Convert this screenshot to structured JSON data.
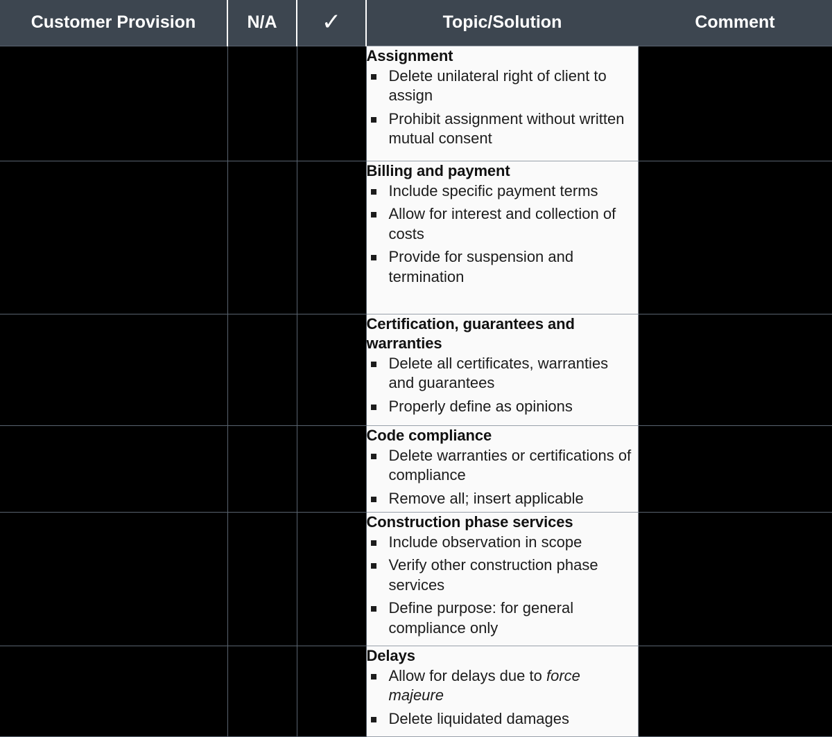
{
  "table": {
    "columns": [
      {
        "key": "provision",
        "label": "Customer Provision",
        "align": "center"
      },
      {
        "key": "na",
        "label": "N/A",
        "align": "center"
      },
      {
        "key": "check",
        "label": "✓",
        "align": "center",
        "icon": "check-icon"
      },
      {
        "key": "topic",
        "label": "Topic/Solution",
        "align": "center"
      },
      {
        "key": "comment",
        "label": "Comment",
        "align": "center"
      }
    ],
    "colors": {
      "header_background": "#3d4650",
      "header_text": "#ffffff",
      "dark_cell_background": "#000000",
      "topic_cell_background": "#fafafa",
      "grid_line": "#98a0aa",
      "dark_grid_line": "#5a6470",
      "body_text": "#1c1c1c"
    },
    "rows": [
      {
        "provision": "",
        "na": "",
        "check": "",
        "comment": "",
        "topic": {
          "title": "Assignment",
          "items": [
            "Delete unilateral right of client to assign",
            "Prohibit assignment without written mutual consent"
          ]
        }
      },
      {
        "provision": "",
        "na": "",
        "check": "",
        "comment": "",
        "topic": {
          "title": "Billing and payment",
          "items": [
            "Include specific payment terms",
            "Allow for interest and collection of costs",
            "Provide for suspension and termination"
          ]
        }
      },
      {
        "provision": "",
        "na": "",
        "check": "",
        "comment": "",
        "topic": {
          "title": "Certification, guarantees and warranties",
          "items": [
            "Delete all certificates, warranties and guarantees",
            "Properly define as opinions"
          ]
        }
      },
      {
        "provision": "",
        "na": "",
        "check": "",
        "comment": "",
        "topic": {
          "title": "Code compliance",
          "items": [
            "Delete warranties or certifications of compliance",
            "Remove all; insert applicable"
          ]
        }
      },
      {
        "provision": "",
        "na": "",
        "check": "",
        "comment": "",
        "topic": {
          "title": "Construction phase services",
          "items": [
            "Include observation in scope",
            "Verify other construction phase services",
            "Define purpose: for general compliance only"
          ]
        }
      },
      {
        "provision": "",
        "na": "",
        "check": "",
        "comment": "",
        "topic": {
          "title": "Delays",
          "items": [
            "Allow for delays due to force majeure",
            "Delete liquidated damages"
          ],
          "italic_phrases": [
            "force majeure"
          ]
        }
      }
    ]
  }
}
